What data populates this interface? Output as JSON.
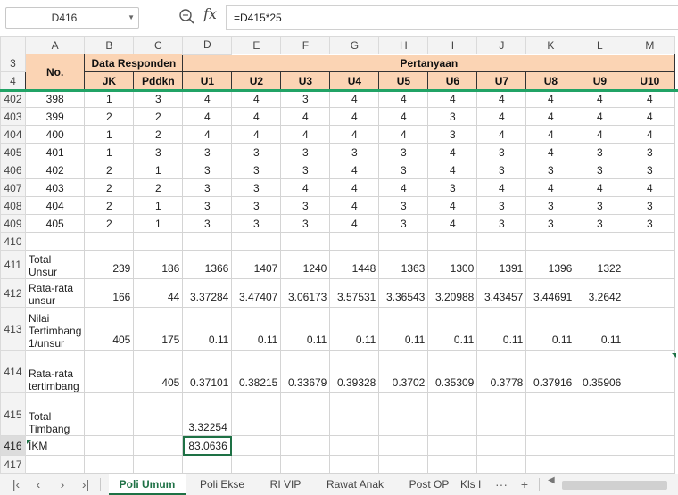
{
  "formula_bar": {
    "name_box": "D416",
    "fx_label": "fx",
    "formula": "=D415*25"
  },
  "columns": [
    "A",
    "B",
    "C",
    "D",
    "E",
    "F",
    "G",
    "H",
    "I",
    "J",
    "K",
    "L",
    "M"
  ],
  "header_rows": {
    "row3_label": "3",
    "row4_label": "4",
    "no_label": "No.",
    "data_responden": "Data Responden",
    "pertanyaan": "Pertanyaan",
    "sub": [
      "JK",
      "Pddkn",
      "U1",
      "U2",
      "U3",
      "U4",
      "U5",
      "U6",
      "U7",
      "U8",
      "U9",
      "U10"
    ]
  },
  "data_rows": [
    {
      "row": "402",
      "cells": [
        "398",
        "1",
        "3",
        "4",
        "4",
        "3",
        "4",
        "4",
        "4",
        "4",
        "4",
        "4",
        "4"
      ]
    },
    {
      "row": "403",
      "cells": [
        "399",
        "2",
        "2",
        "4",
        "4",
        "4",
        "4",
        "4",
        "3",
        "4",
        "4",
        "4",
        "4"
      ]
    },
    {
      "row": "404",
      "cells": [
        "400",
        "1",
        "2",
        "4",
        "4",
        "4",
        "4",
        "4",
        "3",
        "4",
        "4",
        "4",
        "4"
      ]
    },
    {
      "row": "405",
      "cells": [
        "401",
        "1",
        "3",
        "3",
        "3",
        "3",
        "3",
        "3",
        "4",
        "3",
        "4",
        "3",
        "3"
      ]
    },
    {
      "row": "406",
      "cells": [
        "402",
        "2",
        "1",
        "3",
        "3",
        "3",
        "4",
        "3",
        "4",
        "3",
        "3",
        "3",
        "3"
      ]
    },
    {
      "row": "407",
      "cells": [
        "403",
        "2",
        "2",
        "3",
        "3",
        "4",
        "4",
        "4",
        "3",
        "4",
        "4",
        "4",
        "4"
      ]
    },
    {
      "row": "408",
      "cells": [
        "404",
        "2",
        "1",
        "3",
        "3",
        "3",
        "4",
        "3",
        "4",
        "3",
        "3",
        "3",
        "3"
      ]
    },
    {
      "row": "409",
      "cells": [
        "405",
        "2",
        "1",
        "3",
        "3",
        "3",
        "4",
        "3",
        "4",
        "3",
        "3",
        "3",
        "3"
      ]
    }
  ],
  "summary_rows": {
    "r410": {
      "row": "410"
    },
    "r411": {
      "row": "411",
      "label": "Total Unsur",
      "cells": [
        "239",
        "186",
        "1366",
        "1407",
        "1240",
        "1448",
        "1363",
        "1300",
        "1391",
        "1396",
        "1322"
      ]
    },
    "r412": {
      "row": "412",
      "label": "Rata-rata unsur",
      "cells": [
        "166",
        "44",
        "3.37284",
        "3.47407",
        "3.06173",
        "3.57531",
        "3.36543",
        "3.20988",
        "3.43457",
        "3.44691",
        "3.2642"
      ]
    },
    "r413": {
      "row": "413",
      "label": "Nilai Tertimbang 1/unsur",
      "cells": [
        "405",
        "175",
        "0.11",
        "0.11",
        "0.11",
        "0.11",
        "0.11",
        "0.11",
        "0.11",
        "0.11",
        "0.11"
      ]
    },
    "r414": {
      "row": "414",
      "label": "Rata-rata tertimbang",
      "cells": [
        "",
        "405",
        "0.37101",
        "0.38215",
        "0.33679",
        "0.39328",
        "0.3702",
        "0.35309",
        "0.3778",
        "0.37916",
        "0.35906"
      ]
    },
    "r415": {
      "row": "415",
      "label": "Total Timbang",
      "value": "3.32254"
    },
    "r416": {
      "row": "416",
      "label": "IKM",
      "value": "83.0636"
    },
    "r417": {
      "row": "417"
    }
  },
  "sheet_tabs": {
    "tabs": [
      "Poli Umum",
      "Poli Ekse",
      "RI VIP",
      "Rawat Anak",
      "Post OP",
      "Kls I"
    ],
    "active": "Poli Umum",
    "more": "···",
    "add": "+"
  },
  "colors": {
    "header_fill": "#fbd4b4",
    "accent": "#1e7145",
    "freeze": "#21a366"
  }
}
